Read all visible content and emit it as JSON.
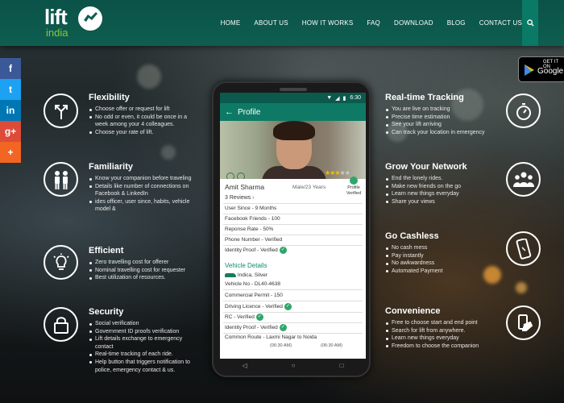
{
  "brand": {
    "logo_text": "lift",
    "logo_sub": "india",
    "accent": "#8cc63f",
    "header_color": "#0e5e50"
  },
  "nav": {
    "items": [
      "HOME",
      "ABOUT US",
      "HOW IT WORKS",
      "FAQ",
      "DOWNLOAD",
      "BLOG",
      "CONTACT US"
    ],
    "search_icon": "search-icon"
  },
  "social": [
    {
      "glyph": "f",
      "icon": "facebook-icon",
      "color": "#3b5998"
    },
    {
      "glyph": "t",
      "icon": "twitter-icon",
      "color": "#1da1f2"
    },
    {
      "glyph": "in",
      "icon": "linkedin-icon",
      "color": "#0077b5"
    },
    {
      "glyph": "g+",
      "icon": "google-plus-icon",
      "color": "#dd4b39"
    },
    {
      "glyph": "+",
      "icon": "share-plus-icon",
      "color": "#f26522"
    }
  ],
  "play_badge": {
    "line1": "GET IT ON",
    "line2": "Google"
  },
  "features_left": [
    {
      "title": "Flexibility",
      "icon": "directions-icon",
      "bullets": [
        "Choose offer or request for lift",
        "No odd or even, it could be once in a week among your 4 colleagues.",
        "Choose your rate of lift."
      ]
    },
    {
      "title": "Familiarity",
      "icon": "people-icon",
      "bullets": [
        "Know your companion before traveling",
        "Details like number of connections on Facebook & LinkedIn",
        "ides officer, user since, habits, vehicle model &"
      ]
    },
    {
      "title": "Efficient",
      "icon": "lightbulb-icon",
      "bullets": [
        "Zero travelling cost for offerer",
        "Nominal travelling cost for requester",
        "Best utilization of resources."
      ]
    },
    {
      "title": "Security",
      "icon": "lock-icon",
      "bullets": [
        "Social verification",
        "Government ID proofs verification",
        "Lift details exchange to emergency contact",
        "Real-time tracking of each ride.",
        "Help button that triggers notification to police, emergency contact & us."
      ]
    }
  ],
  "features_right": [
    {
      "title": "Real-time Tracking",
      "icon": "stopwatch-icon",
      "bullets": [
        "You are live on tracking",
        "Precise time estimation",
        "See your lift arriving",
        "Can track your location in emergency"
      ]
    },
    {
      "title": "Grow Your Network",
      "icon": "group-icon",
      "bullets": [
        "End the lonely rides.",
        "Make new friends on the go",
        "Learn new things everyday",
        "Share your views"
      ]
    },
    {
      "title": "Go Cashless",
      "icon": "phone-payment-icon",
      "bullets": [
        "No cash mess",
        "Pay instantly",
        "No awkwardness",
        "Automated Payment"
      ]
    },
    {
      "title": "Convenience",
      "icon": "phone-hand-icon",
      "bullets": [
        "Free to choose start and end point",
        "Search for lift from anywhere.",
        "Learn new things everyday",
        "Freedom to choose the companion"
      ]
    }
  ],
  "phone": {
    "time": "6:30",
    "appbar_title": "Profile",
    "rating_stars": 3,
    "rating_max": 5,
    "name": "Amit Sharma",
    "gender_age": "Male/23 Years",
    "verified_label": "Profile Verified",
    "reviews": "3 Reviews",
    "user_since": "User Since - 9 Months",
    "fb_friends": "Facebook Friends - 100",
    "response_rate": "Reponse Rate - 50%",
    "phone_number": "Phone Number - Verified",
    "identity_proof": "Identity Proof - Verified",
    "vehicle_title": "Vehicle Details",
    "vehicle_model": "Indica, Silver",
    "vehicle_no": "Vehicle No - DL40-4638",
    "commercial_permit": "Commercial Permit - 150",
    "driving_licence": "Driving Licence - Verified",
    "rc": "RC - Verified",
    "identity_proof2": "Identity Proof - Verified",
    "common_route": "Common Route - Laxmi Nagar to Noida",
    "time_from": "(06:30 AM)",
    "time_to": "(06:30 AM)"
  }
}
